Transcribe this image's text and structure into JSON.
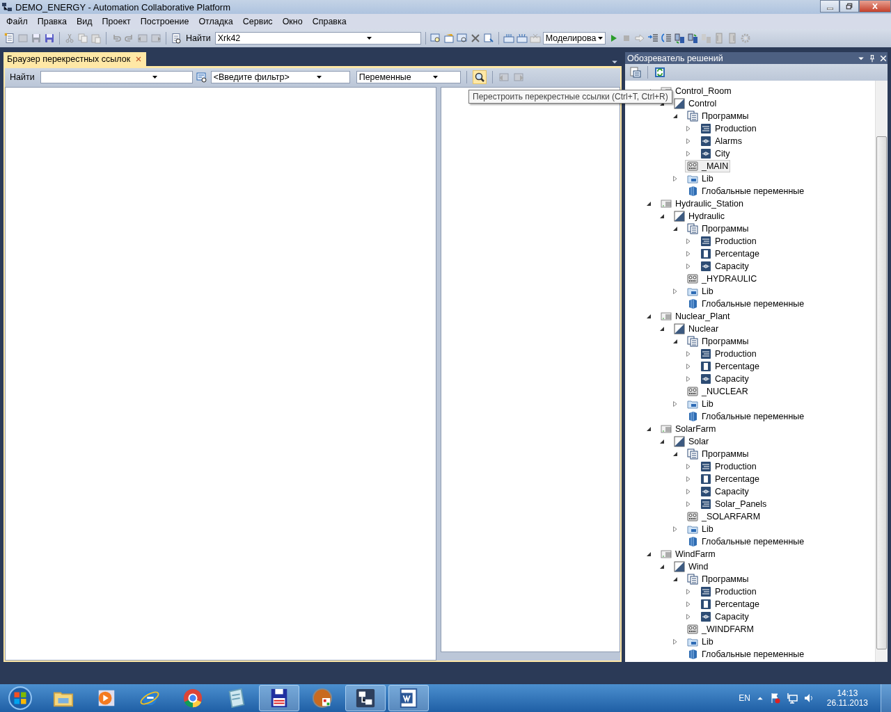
{
  "window": {
    "title": "DEMO_ENERGY - Automation Collaborative Platform"
  },
  "menu": [
    "Файл",
    "Правка",
    "Вид",
    "Проект",
    "Построение",
    "Отладка",
    "Сервис",
    "Окно",
    "Справка"
  ],
  "toolbar": {
    "find_label": "Найти",
    "find_value": "Xrk42",
    "mode_value": "Моделирова"
  },
  "document_tabs": [
    {
      "label": "Браузер перекрестных ссылок",
      "selected": true
    }
  ],
  "cross_reference": {
    "find_label": "Найти",
    "filter_value": "<Введите фильтр>",
    "scope_value": "Переменные"
  },
  "tooltip": "Перестроить перекрестные ссылки (Ctrl+T, Ctrl+R)",
  "solution_explorer": {
    "title": "Обозреватель решений",
    "tree": [
      {
        "label": "Control_Room",
        "kind": "device",
        "expanded": true,
        "selected": false,
        "children": [
          {
            "label": "Control",
            "kind": "app",
            "expanded": true,
            "selected": false,
            "children": [
              {
                "label": "Программы",
                "kind": "programs",
                "expanded": true,
                "selected": false,
                "children": [
                  {
                    "label": "Production",
                    "kind": "prog_lines",
                    "expanded": false,
                    "selected": false
                  },
                  {
                    "label": "Alarms",
                    "kind": "prog_blocks",
                    "expanded": false,
                    "selected": false
                  },
                  {
                    "label": "City",
                    "kind": "prog_blocks",
                    "expanded": false,
                    "selected": false
                  }
                ]
              },
              {
                "label": "_MAIN",
                "kind": "task",
                "selected": true
              },
              {
                "label": "Lib",
                "kind": "lib",
                "expanded": false,
                "selected": false
              },
              {
                "label": "Глобальные переменные",
                "kind": "globals",
                "selected": false
              }
            ]
          }
        ]
      },
      {
        "label": "Hydraulic_Station",
        "kind": "device",
        "expanded": true,
        "selected": false,
        "children": [
          {
            "label": "Hydraulic",
            "kind": "app",
            "expanded": true,
            "selected": false,
            "children": [
              {
                "label": "Программы",
                "kind": "programs",
                "expanded": true,
                "selected": false,
                "children": [
                  {
                    "label": "Production",
                    "kind": "prog_lines",
                    "expanded": false,
                    "selected": false
                  },
                  {
                    "label": "Percentage",
                    "kind": "prog_bar",
                    "expanded": false,
                    "selected": false
                  },
                  {
                    "label": "Capacity",
                    "kind": "prog_blocks",
                    "expanded": false,
                    "selected": false
                  }
                ]
              },
              {
                "label": "_HYDRAULIC",
                "kind": "task",
                "selected": false
              },
              {
                "label": "Lib",
                "kind": "lib",
                "expanded": false,
                "selected": false
              },
              {
                "label": "Глобальные переменные",
                "kind": "globals",
                "selected": false
              }
            ]
          }
        ]
      },
      {
        "label": "Nuclear_Plant",
        "kind": "device",
        "expanded": true,
        "selected": false,
        "children": [
          {
            "label": "Nuclear",
            "kind": "app",
            "expanded": true,
            "selected": false,
            "children": [
              {
                "label": "Программы",
                "kind": "programs",
                "expanded": true,
                "selected": false,
                "children": [
                  {
                    "label": "Production",
                    "kind": "prog_lines",
                    "expanded": false,
                    "selected": false
                  },
                  {
                    "label": "Percentage",
                    "kind": "prog_bar",
                    "expanded": false,
                    "selected": false
                  },
                  {
                    "label": "Capacity",
                    "kind": "prog_blocks",
                    "expanded": false,
                    "selected": false
                  }
                ]
              },
              {
                "label": "_NUCLEAR",
                "kind": "task",
                "selected": false
              },
              {
                "label": "Lib",
                "kind": "lib",
                "expanded": false,
                "selected": false
              },
              {
                "label": "Глобальные переменные",
                "kind": "globals",
                "selected": false
              }
            ]
          }
        ]
      },
      {
        "label": "SolarFarm",
        "kind": "device",
        "expanded": true,
        "selected": false,
        "children": [
          {
            "label": "Solar",
            "kind": "app",
            "expanded": true,
            "selected": false,
            "children": [
              {
                "label": "Программы",
                "kind": "programs",
                "expanded": true,
                "selected": false,
                "children": [
                  {
                    "label": "Production",
                    "kind": "prog_lines",
                    "expanded": false,
                    "selected": false
                  },
                  {
                    "label": "Percentage",
                    "kind": "prog_bar",
                    "expanded": false,
                    "selected": false
                  },
                  {
                    "label": "Capacity",
                    "kind": "prog_blocks",
                    "expanded": false,
                    "selected": false
                  },
                  {
                    "label": "Solar_Panels",
                    "kind": "prog_lines",
                    "expanded": false,
                    "selected": false
                  }
                ]
              },
              {
                "label": "_SOLARFARM",
                "kind": "task",
                "selected": false
              },
              {
                "label": "Lib",
                "kind": "lib",
                "expanded": false,
                "selected": false
              },
              {
                "label": "Глобальные переменные",
                "kind": "globals",
                "selected": false
              }
            ]
          }
        ]
      },
      {
        "label": "WindFarm",
        "kind": "device",
        "expanded": true,
        "selected": false,
        "children": [
          {
            "label": "Wind",
            "kind": "app",
            "expanded": true,
            "selected": false,
            "children": [
              {
                "label": "Программы",
                "kind": "programs",
                "expanded": true,
                "selected": false,
                "children": [
                  {
                    "label": "Production",
                    "kind": "prog_lines",
                    "expanded": false,
                    "selected": false
                  },
                  {
                    "label": "Percentage",
                    "kind": "prog_bar",
                    "expanded": false,
                    "selected": false
                  },
                  {
                    "label": "Capacity",
                    "kind": "prog_blocks",
                    "expanded": false,
                    "selected": false
                  }
                ]
              },
              {
                "label": "_WINDFARM",
                "kind": "task",
                "selected": false
              },
              {
                "label": "Lib",
                "kind": "lib",
                "expanded": false,
                "selected": false
              },
              {
                "label": "Глобальные переменные",
                "kind": "globals",
                "selected": false
              }
            ]
          }
        ]
      }
    ]
  },
  "taskbar": {
    "apps": [
      {
        "running": false
      },
      {
        "running": false
      },
      {
        "running": false
      },
      {
        "running": false
      },
      {
        "running": false
      },
      {
        "running": false
      },
      {
        "running": true
      },
      {
        "running": false
      },
      {
        "running": true
      },
      {
        "running": true
      }
    ],
    "language": "EN",
    "time": "14:13",
    "date": "26.11.2013"
  }
}
